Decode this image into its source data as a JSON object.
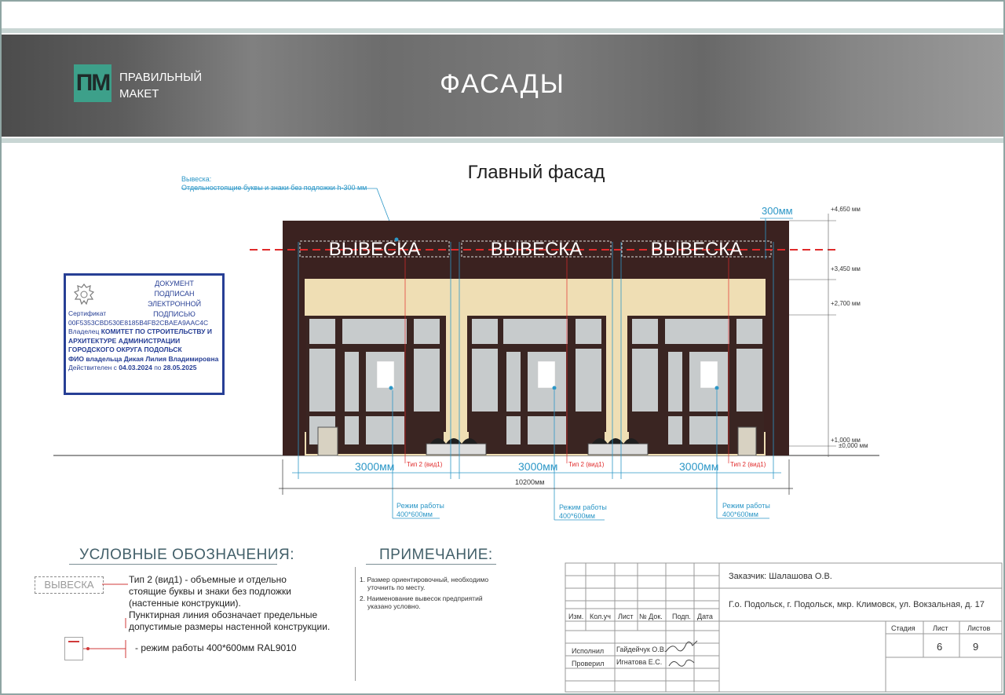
{
  "header": {
    "logo_mark": "ПМ",
    "logo_line1": "ПРАВИЛЬНЫЙ",
    "logo_line2": "МАКЕТ",
    "title": "ФАСАДЫ"
  },
  "drawing": {
    "title": "Главный фасад",
    "sign_note_line1": "Вывеска:",
    "sign_note_line2": "Отдельностоящие буквы и знаки без подложки h-300 мм",
    "sign_text": "ВЫВЕСКА",
    "dim_300": "300мм",
    "level_4650": "+4,650 мм",
    "level_3450": "+3,450 мм",
    "level_2700": "+2,700 мм",
    "level_1000": "+1,000 мм",
    "level_0000": "±0,000 мм",
    "dim_3000": "3000мм",
    "type_label": "Тип 2 (вид1)",
    "dim_total": "10200мм",
    "hours_line1": "Режим работы",
    "hours_line2": "400*600мм",
    "colors": {
      "wall": "#3b2220",
      "beige": "#efdeb4",
      "glass": "#c7cbcc",
      "frame": "#3a2522",
      "blue": "#2c97c7",
      "red": "#e02b2b"
    }
  },
  "stamp": {
    "line1": "ДОКУМЕНТ ПОДПИСАН",
    "line2": "ЭЛЕКТРОННОЙ",
    "line3": "ПОДПИСЬЮ",
    "cert_label": "Сертификат",
    "cert": "00F5353CBD530E8185B4FB2CBAEA9AAC4C",
    "owner_label": "Владелец",
    "owner": "КОМИТЕТ ПО СТРОИТЕЛЬСТВУ И АРХИТЕКТУРЕ АДМИНИСТРАЦИИ ГОРОДСКОГО ОКРУГА ПОДОЛЬСК",
    "fio": "ФИО владельца Дикая Лилия Владимировна",
    "valid_label": "Действителен",
    "from_label": "с",
    "from": "04.03.2024",
    "to_label": "по",
    "to": "28.05.2025"
  },
  "legend": {
    "title": "УСЛОВНЫЕ ОБОЗНАЧЕНИЯ:",
    "box_label": "ВЫВЕСКА",
    "desc1": "Тип 2 (вид1) - объемные и отдельно",
    "desc2": "стоящие буквы и знаки без подложки",
    "desc3": "(настенные конструкции).",
    "desc4": "Пунктирная линия обозначает предельные",
    "desc5": "допустимые размеры настенной конструкции.",
    "mark_desc": "- режим работы 400*600мм RAL9010"
  },
  "notes": {
    "title": "ПРИМЕЧАНИЕ:",
    "n1a": "1. Размер ориентировочный, необходимо",
    "n1b": "уточнить по месту.",
    "n2a": "2. Наименование вывесок предприятий",
    "n2b": "указано условно."
  },
  "titleblock": {
    "col_izm": "Изм.",
    "col_kol": "Кол.уч",
    "col_list": "Лист",
    "col_doc": "№ Док.",
    "col_sign": "Подп.",
    "col_date": "Дата",
    "role1": "Исполнил",
    "name1": "Гайдейчук О.В.",
    "role2": "Проверил",
    "name2": "Игнатова Е.С.",
    "customer": "Заказчик: Шалашова О.В.",
    "address": "Г.о. Подольск, г. Подольск, мкр. Климовск, ул. Вокзальная, д. 17",
    "stage_label": "Стадия",
    "sheet_label": "Лист",
    "sheets_label": "Листов",
    "stage": "",
    "sheet": "6",
    "sheets": "9"
  }
}
